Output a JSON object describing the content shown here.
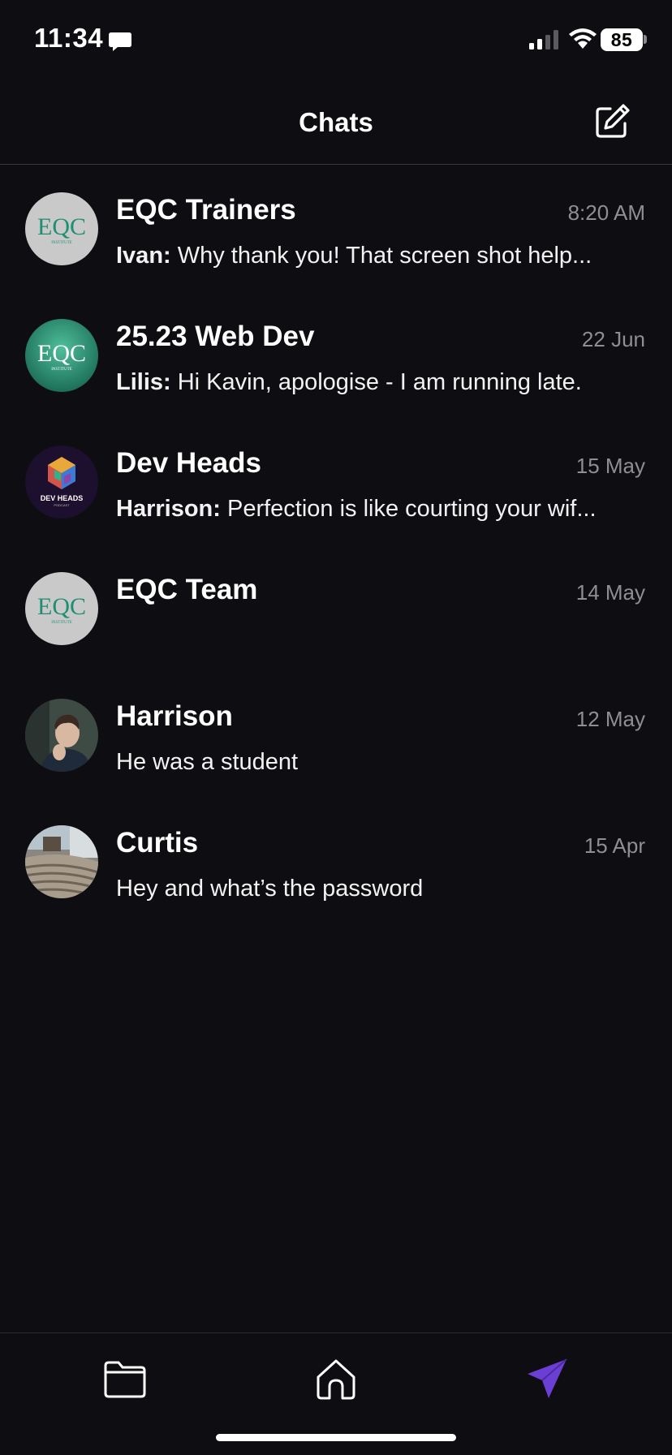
{
  "status_bar": {
    "time": "11:34",
    "battery": "85"
  },
  "header": {
    "title": "Chats"
  },
  "chats": [
    {
      "name": "EQC Trainers",
      "time": "8:20 AM",
      "sender": "Ivan:",
      "message": "Why thank you!   That screen shot help...",
      "avatar_text": "EQC",
      "avatar_subtext": "INSTITUTE"
    },
    {
      "name": "25.23 Web Dev",
      "time": "22 Jun",
      "sender": "Lilis:",
      "message": "Hi Kavin, apologise - I am running late.",
      "avatar_text": "EQC",
      "avatar_subtext": "INSTITUTE"
    },
    {
      "name": "Dev Heads",
      "time": "15 May",
      "sender": "Harrison:",
      "message": "Perfection is like courting your wif...",
      "avatar_text": "DEV HEADS",
      "avatar_subtext": "PODCAST"
    },
    {
      "name": "EQC Team",
      "time": "14 May",
      "sender": "",
      "message": "",
      "avatar_text": "EQC",
      "avatar_subtext": "INSTITUTE"
    },
    {
      "name": "Harrison",
      "time": "12 May",
      "sender": "",
      "message": "He was a student"
    },
    {
      "name": "Curtis",
      "time": "15 Apr",
      "sender": "",
      "message": "Hey and what’s the password"
    }
  ],
  "tab_bar": {
    "tabs": [
      {
        "icon": "folder-icon"
      },
      {
        "icon": "home-icon"
      },
      {
        "icon": "send-icon"
      }
    ]
  },
  "colors": {
    "background": "#0e0e12",
    "accent": "#6b3fd4",
    "eqc_green": "#1f8f72",
    "muted_text": "#8e8e93"
  }
}
